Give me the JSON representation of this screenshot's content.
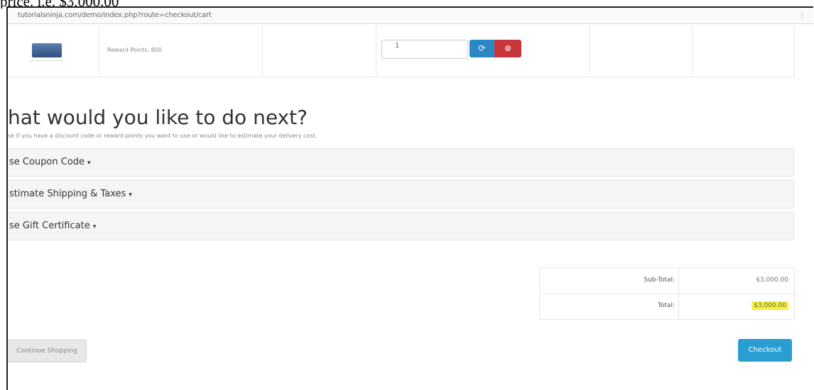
{
  "caption": "price. i.e. $3,000.00",
  "browser": {
    "url": "tutorialsninja.com/demo/index.php?route=checkout/cart",
    "menu_icon": "menu-icon"
  },
  "cart_row": {
    "product_name": "Reward Points: 800",
    "quantity": "1",
    "update_icon": "refresh-icon",
    "remove_icon": "remove-icon"
  },
  "next_section": {
    "heading": "hat would you like to do next?",
    "hint": "se if you have a discount code or reward points you want to use or would like to estimate your delivery cost.",
    "panels": [
      {
        "label": "se Coupon Code"
      },
      {
        "label": "stimate Shipping & Taxes"
      },
      {
        "label": "se Gift Certificate"
      }
    ],
    "caret": "▾"
  },
  "totals": {
    "rows": [
      {
        "label": "Sub-Total:",
        "value": "$3,000.00"
      },
      {
        "label": "Total:",
        "value": "$3,000.00"
      }
    ]
  },
  "actions": {
    "continue_label": "Continue Shopping",
    "checkout_label": "Checkout"
  },
  "colors": {
    "update_button": "#2a88c4",
    "remove_button": "#c9363a",
    "checkout_button": "#2a9ed1",
    "highlight": "#f6f13a"
  }
}
